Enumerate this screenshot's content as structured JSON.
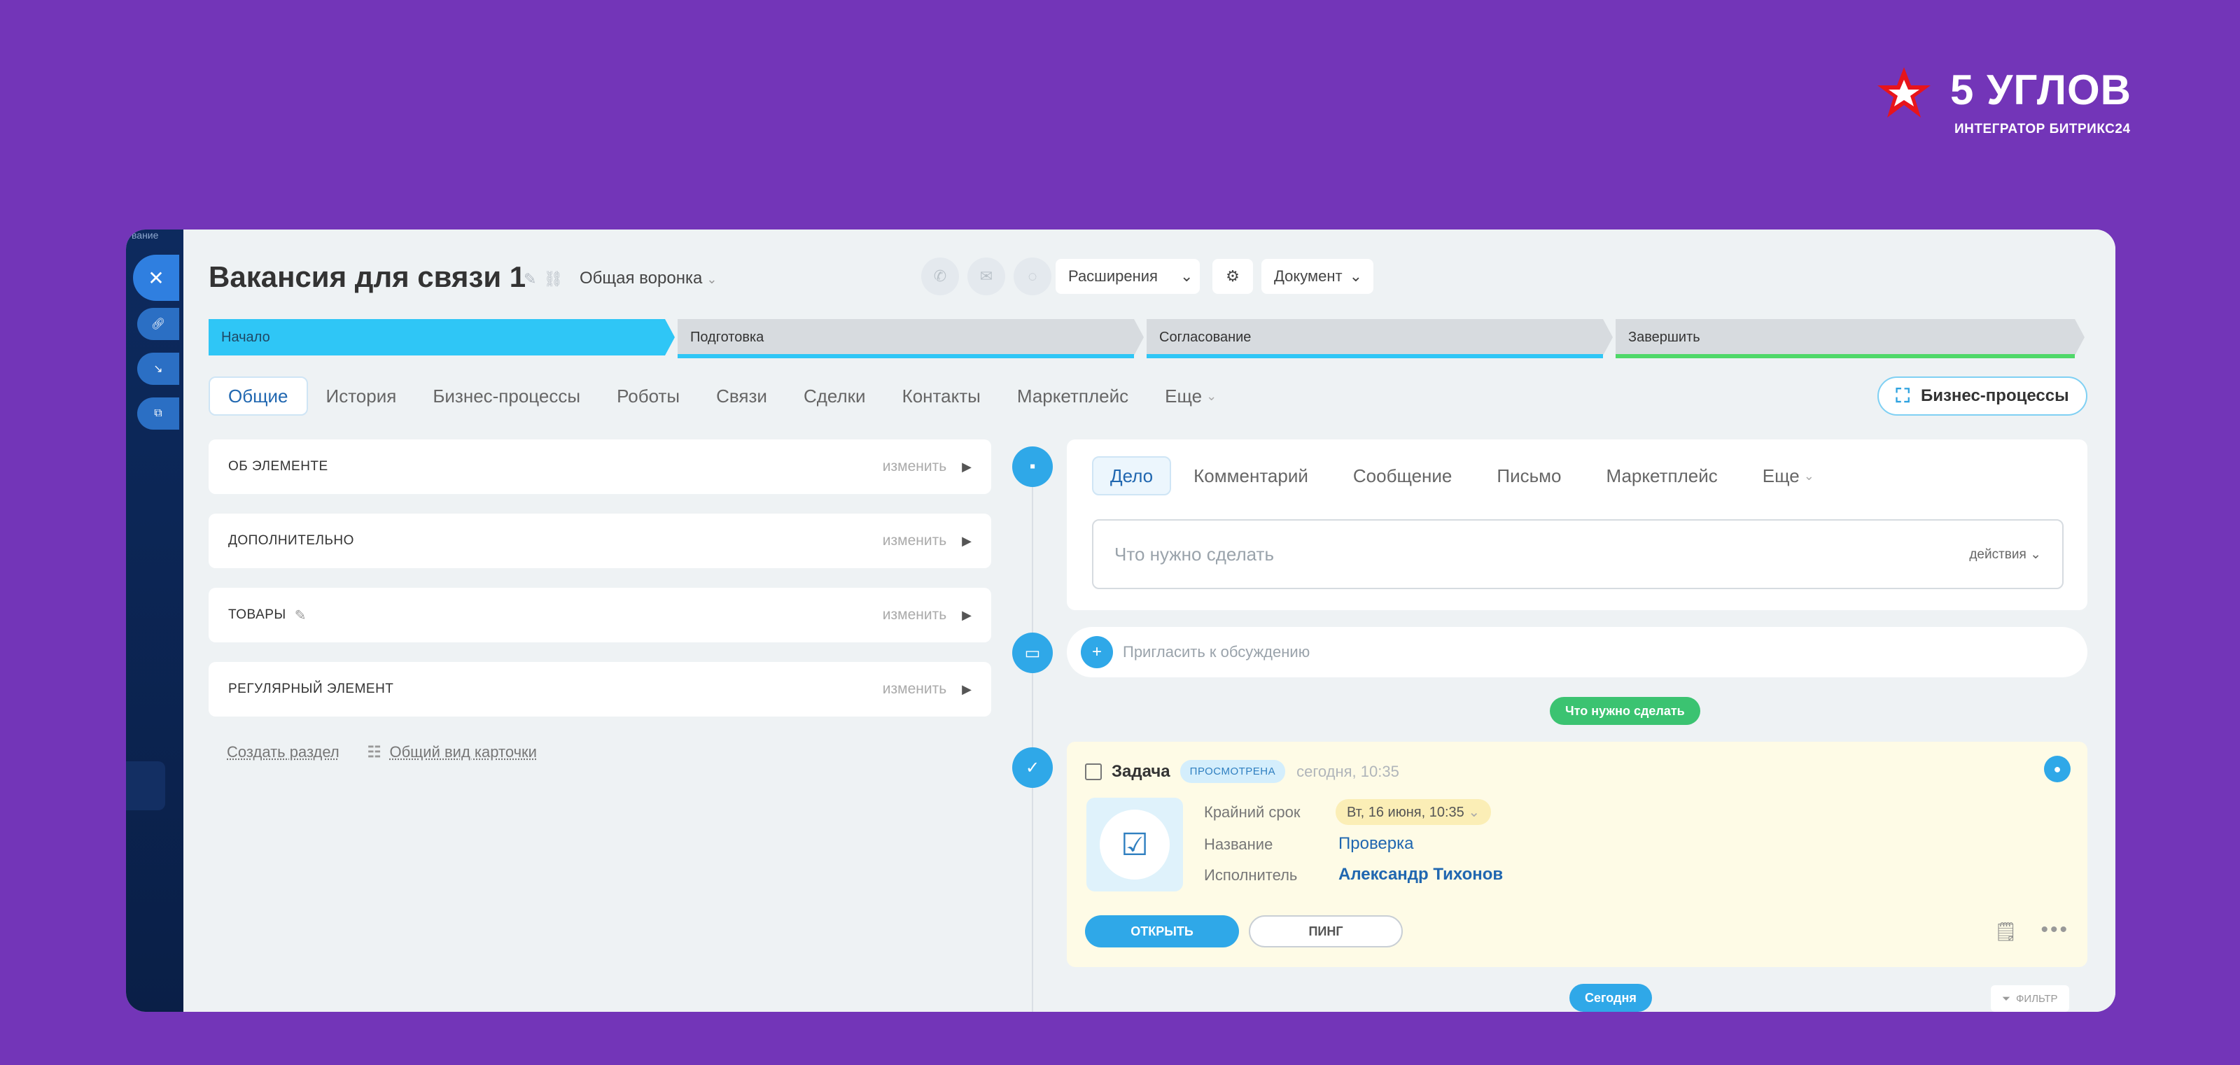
{
  "brand": {
    "title": "5 УГЛОВ",
    "subtitle": "ИНТЕГРАТОР БИТРИКС24",
    "color": "#7335b8"
  },
  "sidebar": {
    "top_fragment": "вание",
    "close_icon": "✕"
  },
  "header": {
    "title": "Вакансия для связи 1",
    "funnel": "Общая воронка",
    "extensions_label": "Расширения",
    "document_label": "Документ"
  },
  "pipeline": {
    "stages": [
      {
        "label": "Начало",
        "state": "active"
      },
      {
        "label": "Подготовка",
        "state": "inactive"
      },
      {
        "label": "Согласование",
        "state": "inactive"
      },
      {
        "label": "Завершить",
        "state": "final"
      }
    ],
    "active_color": "#2fc6f6",
    "final_color": "#4fd869"
  },
  "tabs": [
    {
      "label": "Общие",
      "active": true
    },
    {
      "label": "История"
    },
    {
      "label": "Бизнес-процессы"
    },
    {
      "label": "Роботы"
    },
    {
      "label": "Связи"
    },
    {
      "label": "Сделки"
    },
    {
      "label": "Контакты"
    },
    {
      "label": "Маркетплейс"
    },
    {
      "label": "Еще"
    }
  ],
  "bp_button": "Бизнес-процессы",
  "sections": [
    {
      "name": "ОБ ЭЛЕМЕНТЕ",
      "edit": "изменить"
    },
    {
      "name": "ДОПОЛНИТЕЛЬНО",
      "edit": "изменить"
    },
    {
      "name": "ТОВАРЫ",
      "edit": "изменить"
    },
    {
      "name": "РЕГУЛЯРНЫЙ ЭЛЕМЕНТ",
      "edit": "изменить"
    }
  ],
  "left_links": {
    "create_section": "Создать раздел",
    "common_view": "Общий вид карточки"
  },
  "composer": {
    "tabs": [
      "Дело",
      "Комментарий",
      "Сообщение",
      "Письмо",
      "Маркетплейс",
      "Еще"
    ],
    "placeholder": "Что нужно сделать",
    "actions": "действия"
  },
  "invite": {
    "placeholder": "Пригласить к обсуждению"
  },
  "todo_pill": "Что нужно сделать",
  "task": {
    "title": "Задача",
    "badge": "ПРОСМОТРЕНА",
    "time": "сегодня, 10:35",
    "deadline_label": "Крайний срок",
    "deadline_value": "Вт, 16 июня, 10:35",
    "name_label": "Название",
    "name_value": "Проверка",
    "assignee_label": "Исполнитель",
    "assignee_value": "Александр Тихонов",
    "open_button": "ОТКРЫТЬ",
    "ping_button": "ПИНГ"
  },
  "today_pill": "Сегодня",
  "filter_label": "ФИЛЬТР"
}
